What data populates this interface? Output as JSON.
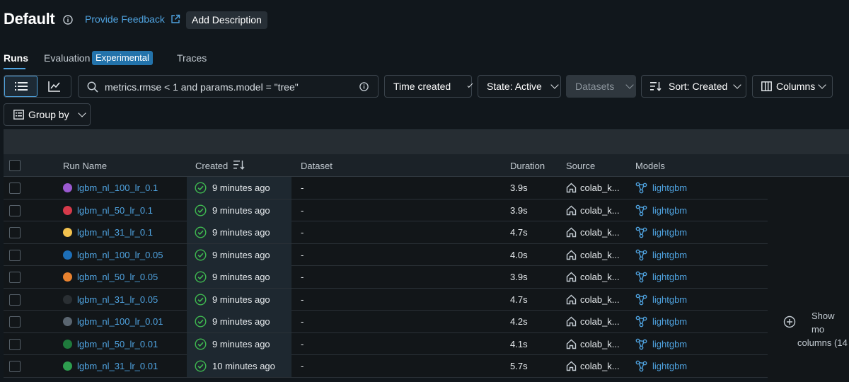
{
  "header": {
    "title": "Default",
    "feedback_label": "Provide Feedback",
    "add_description_label": "Add Description"
  },
  "tabs": [
    {
      "label": "Runs",
      "active": true
    },
    {
      "label": "Evaluation",
      "badge": "Experimental"
    },
    {
      "label": "Traces"
    }
  ],
  "toolbar": {
    "search_value": "metrics.rmse < 1 and params.model = \"tree\"",
    "time_created_label": "Time created",
    "state_label": "State: Active",
    "datasets_label": "Datasets",
    "sort_label": "Sort: Created",
    "columns_label": "Columns",
    "group_by_label": "Group by"
  },
  "table": {
    "columns": [
      "Run Name",
      "Created",
      "Dataset",
      "Duration",
      "Source",
      "Models"
    ],
    "rows": [
      {
        "name": "lgbm_nl_100_lr_0.1",
        "color": "#9b59d0",
        "created": "9 minutes ago",
        "dataset": "-",
        "duration": "3.9s",
        "source": "colab_k...",
        "model": "lightgbm"
      },
      {
        "name": "lgbm_nl_50_lr_0.1",
        "color": "#d63a4a",
        "created": "9 minutes ago",
        "dataset": "-",
        "duration": "3.9s",
        "source": "colab_k...",
        "model": "lightgbm"
      },
      {
        "name": "lgbm_nl_31_lr_0.1",
        "color": "#f2c14e",
        "created": "9 minutes ago",
        "dataset": "-",
        "duration": "4.7s",
        "source": "colab_k...",
        "model": "lightgbm"
      },
      {
        "name": "lgbm_nl_100_lr_0.05",
        "color": "#1d6fb8",
        "created": "9 minutes ago",
        "dataset": "-",
        "duration": "4.0s",
        "source": "colab_k...",
        "model": "lightgbm"
      },
      {
        "name": "lgbm_nl_50_lr_0.05",
        "color": "#e8822f",
        "created": "9 minutes ago",
        "dataset": "-",
        "duration": "3.9s",
        "source": "colab_k...",
        "model": "lightgbm"
      },
      {
        "name": "lgbm_nl_31_lr_0.05",
        "color": "#2a2f33",
        "created": "9 minutes ago",
        "dataset": "-",
        "duration": "4.7s",
        "source": "colab_k...",
        "model": "lightgbm"
      },
      {
        "name": "lgbm_nl_100_lr_0.01",
        "color": "#5a6570",
        "created": "9 minutes ago",
        "dataset": "-",
        "duration": "4.2s",
        "source": "colab_k...",
        "model": "lightgbm"
      },
      {
        "name": "lgbm_nl_50_lr_0.01",
        "color": "#1f7a3c",
        "created": "9 minutes ago",
        "dataset": "-",
        "duration": "4.1s",
        "source": "colab_k...",
        "model": "lightgbm"
      },
      {
        "name": "lgbm_nl_31_lr_0.01",
        "color": "#2e9e4f",
        "created": "10 minutes ago",
        "dataset": "-",
        "duration": "5.7s",
        "source": "colab_k...",
        "model": "lightgbm"
      }
    ],
    "show_more": [
      "Show mo",
      "columns (14"
    ]
  },
  "colors": {
    "accent": "#4fa3e0",
    "success": "#3fb950",
    "background": "#11171c"
  }
}
